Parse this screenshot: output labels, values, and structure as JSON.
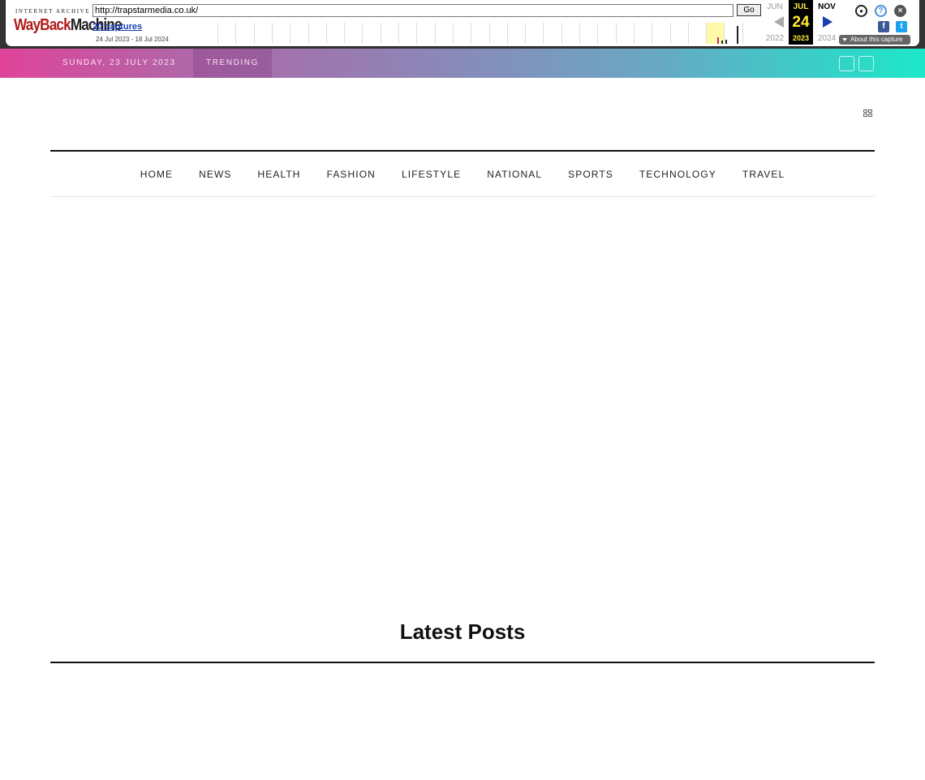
{
  "wayback": {
    "logo_top": "INTERNET ARCHIVE",
    "logo_red": "WayBack",
    "logo_black": "Machine",
    "url": "http://trapstarmedia.co.uk/",
    "go_label": "Go",
    "captures": "20 captures",
    "range": "24 Jul 2023 - 18 Jul 2024",
    "prev_month": "JUN",
    "cur_month": "JUL",
    "next_month": "NOV",
    "cur_day": "24",
    "prev_year": "2022",
    "cur_year": "2023",
    "next_year": "2024",
    "about": "About this capture",
    "fb": "f",
    "tw": "t",
    "help": "?",
    "close": "×",
    "capture_bars": [
      {
        "index": 0,
        "level": 0.3
      },
      {
        "index": 1,
        "level": 0.15
      },
      {
        "index": 2,
        "level": 0.2
      },
      {
        "index": 3,
        "level": 0.85
      }
    ]
  },
  "topbar": {
    "date": "SUNDAY, 23 JULY 2023",
    "trending": "TRENDING"
  },
  "nav": {
    "items": [
      {
        "label": "HOME"
      },
      {
        "label": "NEWS"
      },
      {
        "label": "HEALTH"
      },
      {
        "label": "FASHION"
      },
      {
        "label": "LIFESTYLE"
      },
      {
        "label": "NATIONAL"
      },
      {
        "label": "SPORTS"
      },
      {
        "label": "TECHNOLOGY"
      },
      {
        "label": "TRAVEL"
      }
    ]
  },
  "latest": {
    "title": "Latest Posts"
  },
  "colors": {
    "gradient_start": "#e0449a",
    "gradient_end": "#1ee8c9",
    "wayback_red": "#b01b1b",
    "wayback_yellow": "#ffeb3b"
  }
}
